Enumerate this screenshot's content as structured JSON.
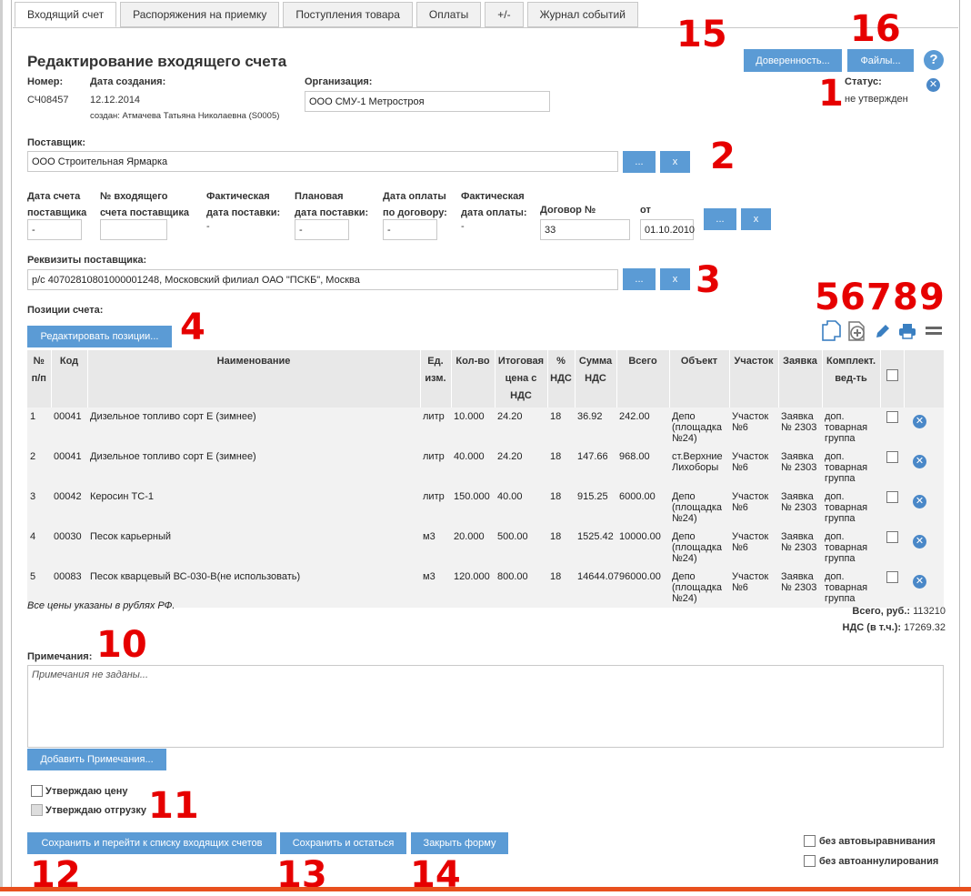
{
  "tabs": [
    {
      "label": "Входящий счет",
      "active": true
    },
    {
      "label": "Распоряжения на приемку"
    },
    {
      "label": "Поступления товара"
    },
    {
      "label": "Оплаты"
    },
    {
      "label": "+/-"
    },
    {
      "label": "Журнал событий"
    }
  ],
  "header": {
    "title": "Редактирование входящего счета",
    "proxy_button": "Доверенность...",
    "files_button": "Файлы...",
    "help_icon": "?",
    "close_icon": "✕"
  },
  "meta": {
    "number_label": "Номер:",
    "number_value": "СЧ08457",
    "created_label": "Дата создания:",
    "created_value": "12.12.2014",
    "created_by": "создан: Атмачева Татьяна Николаевна (S0005)",
    "org_label": "Организация:",
    "org_value": "ООО СМУ-1 Метростроя",
    "status_label": "Статус:",
    "status_value": "не утвержден"
  },
  "supplier": {
    "label": "Поставщик:",
    "value": "ООО Строительная Ярмарка",
    "pick_button": "...",
    "clear_button": "x"
  },
  "dates": {
    "invoice_date_label_1": "Дата счета",
    "invoice_date_label_2": "поставщика",
    "invoice_date_value": "-",
    "incoming_no_label_1": "№ входящего",
    "incoming_no_label_2": "счета поставщика",
    "incoming_no_value": "",
    "actual_delivery_label_1": "Фактическая",
    "actual_delivery_label_2": "дата поставки:",
    "actual_delivery_value": "-",
    "planned_delivery_label_1": "Плановая",
    "planned_delivery_label_2": "дата поставки:",
    "planned_delivery_value": "-",
    "pay_contract_label_1": "Дата оплаты",
    "pay_contract_label_2": "по договору:",
    "pay_contract_value": "-",
    "actual_pay_label_1": "Фактическая",
    "actual_pay_label_2": "дата оплаты:",
    "actual_pay_value": "-",
    "contract_label": "Договор №",
    "contract_value": "33",
    "from_label": "от",
    "from_value": "01.10.2010",
    "pick_button": "...",
    "clear_button": "x"
  },
  "requisites": {
    "label": "Реквизиты поставщика:",
    "value": "р/с 40702810801000001248, Московский филиал ОАО \"ПСКБ\", Москва",
    "pick_button": "...",
    "clear_button": "x"
  },
  "positions": {
    "label": "Позиции счета:",
    "edit_button": "Редактировать позиции...",
    "icons": [
      "copy-icon",
      "add-icon",
      "edit-icon",
      "print-icon",
      "menu-icon"
    ],
    "columns": [
      "№ п/п",
      "Код",
      "Наименование",
      "Ед. изм.",
      "Кол-во",
      "Итоговая цена с НДС",
      "% НДС",
      "Сумма НДС",
      "Всего",
      "Объект",
      "Участок",
      "Заявка",
      "Комплект. вед-ть"
    ],
    "rows": [
      {
        "n": "1",
        "code": "00041",
        "name": "Дизельное топливо сорт Е (зимнее)",
        "unit": "литр",
        "qty": "10.000",
        "price": "24.20",
        "vat": "18",
        "vat_sum": "36.92",
        "total": "242.00",
        "object": "Депо (площадка №24)",
        "site": "Участок №6",
        "request": "Заявка № 2303",
        "kit": "доп. товарная группа"
      },
      {
        "n": "2",
        "code": "00041",
        "name": "Дизельное топливо сорт Е (зимнее)",
        "unit": "литр",
        "qty": "40.000",
        "price": "24.20",
        "vat": "18",
        "vat_sum": "147.66",
        "total": "968.00",
        "object": "ст.Верхние Лихоборы",
        "site": "Участок №6",
        "request": "Заявка № 2303",
        "kit": "доп. товарная группа"
      },
      {
        "n": "3",
        "code": "00042",
        "name": "Керосин ТС-1",
        "unit": "литр",
        "qty": "150.000",
        "price": "40.00",
        "vat": "18",
        "vat_sum": "915.25",
        "total": "6000.00",
        "object": "Депо (площадка №24)",
        "site": "Участок №6",
        "request": "Заявка № 2303",
        "kit": "доп. товарная группа"
      },
      {
        "n": "4",
        "code": "00030",
        "name": "Песок карьерный",
        "unit": "м3",
        "qty": "20.000",
        "price": "500.00",
        "vat": "18",
        "vat_sum": "1525.42",
        "total": "10000.00",
        "object": "Депо (площадка №24)",
        "site": "Участок №6",
        "request": "Заявка № 2303",
        "kit": "доп. товарная группа"
      },
      {
        "n": "5",
        "code": "00083",
        "name": "Песок кварцевый ВС-030-В(не использовать)",
        "unit": "м3",
        "qty": "120.000",
        "price": "800.00",
        "vat": "18",
        "vat_sum": "14644.07",
        "total": "96000.00",
        "object": "Депо (площадка №24)",
        "site": "Участок №6",
        "request": "Заявка № 2303",
        "kit": "доп. товарная группа"
      }
    ],
    "currency_note": "Все цены указаны в рублях РФ.",
    "total_label": "Всего, руб.:",
    "total_value": "113210",
    "vat_label": "НДС (в т.ч.):",
    "vat_value": "17269.32"
  },
  "notes": {
    "label": "Примечания:",
    "placeholder": "Примечания не заданы...",
    "add_button": "Добавить Примечания..."
  },
  "approvals": {
    "price": "Утверждаю цену",
    "shipment": "Утверждаю отгрузку"
  },
  "footer": {
    "save_go": "Сохранить и перейти к списку входящих счетов",
    "save_stay": "Сохранить и остаться",
    "close": "Закрыть форму",
    "no_autoalign": "без автовыравнивания",
    "no_autocancel": "без автоаннулирования"
  },
  "markers": [
    "1",
    "2",
    "3",
    "4",
    "5",
    "6",
    "7",
    "8",
    "9",
    "10",
    "11",
    "12",
    "13",
    "14",
    "15",
    "16"
  ],
  "colors": {
    "accent": "#5b9bd5",
    "marker": "#e60000",
    "bottom_bar": "#e8501e"
  }
}
